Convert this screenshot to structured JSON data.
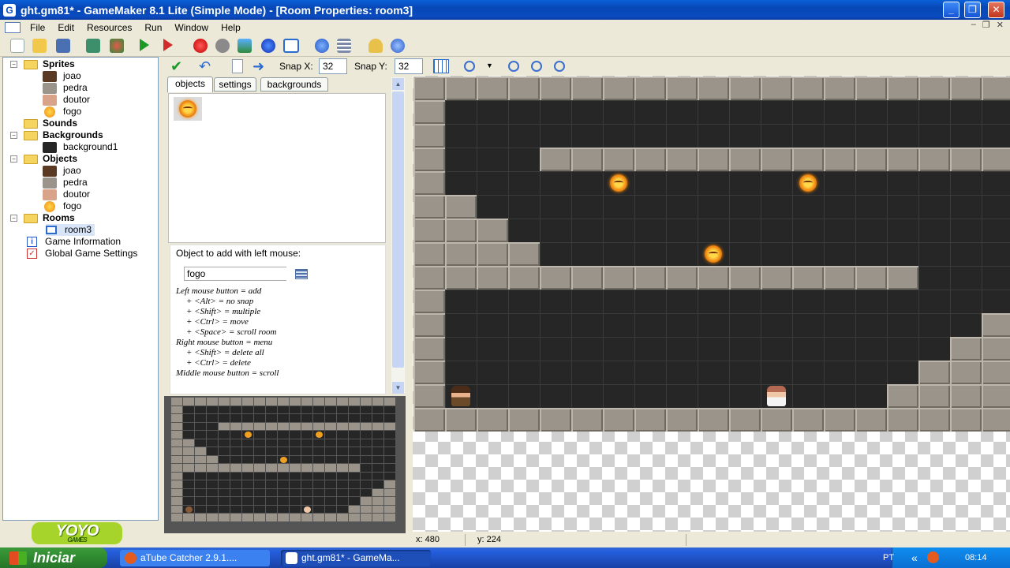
{
  "window": {
    "title": "ght.gm81* - GameMaker 8.1 Lite (Simple Mode) - [Room Properties: room3]",
    "app_icon_letter": "G"
  },
  "menu": [
    "File",
    "Edit",
    "Resources",
    "Run",
    "Window",
    "Help"
  ],
  "tree": {
    "sprites": {
      "label": "Sprites",
      "items": [
        "joao",
        "pedra",
        "doutor",
        "fogo"
      ]
    },
    "sounds": {
      "label": "Sounds"
    },
    "backgrounds": {
      "label": "Backgrounds",
      "items": [
        "background1"
      ]
    },
    "objects": {
      "label": "Objects",
      "items": [
        "joao",
        "pedra",
        "doutor",
        "fogo"
      ]
    },
    "rooms": {
      "label": "Rooms",
      "items": [
        "room3"
      ]
    },
    "game_information": "Game Information",
    "global_settings": "Global Game Settings"
  },
  "logo": {
    "text": "YOYO",
    "sub": "GAMES"
  },
  "room_toolbar": {
    "snap_x_label": "Snap X:",
    "snap_x": "32",
    "snap_y_label": "Snap Y:",
    "snap_y": "32"
  },
  "tabs": [
    "objects",
    "settings",
    "backgrounds"
  ],
  "help": {
    "object_label": "Object to add with left mouse:",
    "selected_object": "fogo",
    "lines": [
      "Left mouse button = add",
      "+ <Alt> = no snap",
      "+ <Shift> = multiple",
      "+ <Ctrl> = move",
      "+ <Space> = scroll room",
      "Right mouse button = menu",
      "+ <Shift> = delete all",
      "+ <Ctrl> = delete",
      "Middle mouse button = scroll"
    ]
  },
  "status": {
    "x": "x: 480",
    "y": "y: 224"
  },
  "taskbar": {
    "start": "Iniciar",
    "tasks": [
      "aTube Catcher 2.9.1....",
      "ght.gm81* - GameMa..."
    ],
    "lang": "PT",
    "clock": "08:14"
  },
  "colors": {
    "wall": "#9a948b",
    "floor": "#262626",
    "titlebar": "#0a4cc0",
    "taskbar": "#245edc",
    "start": "#2f8a2f"
  }
}
